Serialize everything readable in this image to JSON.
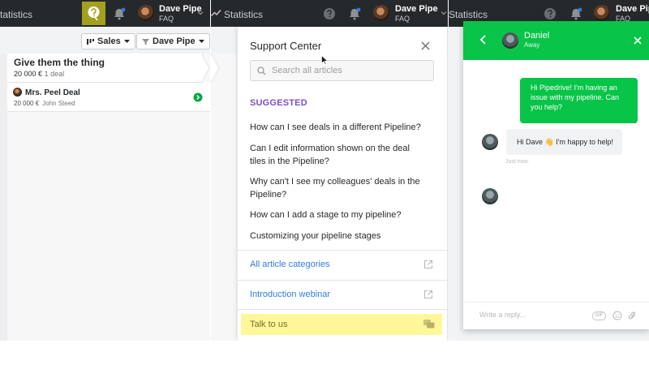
{
  "panel1": {
    "topbar": {
      "nav_label": "tatistics",
      "user_name": "Dave Pipe",
      "user_sub": "FAQ"
    },
    "toolbar": {
      "pipeline_label": "Sales",
      "filter_label": "Dave Pipe"
    },
    "stage": {
      "title": "Give them the thing",
      "amount": "20 000 €",
      "count": "1 deal"
    },
    "deal": {
      "title": "Mrs. Peel Deal",
      "amount": "20 000 €",
      "person": "John Steed"
    }
  },
  "panel2": {
    "topbar": {
      "nav_label": "Statistics",
      "user_name": "Dave Pipe",
      "user_sub": "FAQ"
    }
  },
  "support": {
    "title": "Support Center",
    "search_placeholder": "Search all articles",
    "suggested_label": "SUGGESTED",
    "articles": [
      "How can I see deals in a different Pipeline?",
      "Can I edit information shown on the deal tiles in the Pipeline?",
      "Why can't I see my colleagues' deals in the Pipeline?",
      "How can I add a stage to my pipeline?",
      "Customizing your pipeline stages"
    ],
    "links": [
      "All article categories",
      "Introduction webinar"
    ],
    "talk_label": "Talk to us"
  },
  "panel3": {
    "topbar": {
      "nav_label": "Statistics",
      "user_name": "Dave Pipe",
      "user_sub": "FAQ"
    }
  },
  "chat": {
    "agent_name": "Daniel",
    "agent_status": "Away",
    "user_message": "Hi Pipedrive! I'm having an issue with my pipeline. Can you help?",
    "agent_message": "Hi Dave 👋 I'm happy to help!",
    "timestamp": "Just now.",
    "composer_placeholder": "Write a reply...",
    "gif_label": "GIF"
  },
  "colors": {
    "topbar": "#26292c",
    "help_active": "#a3a01f",
    "suggested": "#7c4fc2",
    "link": "#317ae2",
    "talk_highlight": "#fff79a",
    "chat_green": "#08c448"
  },
  "icons": [
    "lightbulb-icon",
    "bell-icon",
    "help-icon",
    "trend-icon",
    "search-icon",
    "close-icon",
    "external-link-icon",
    "chat-icon",
    "back-arrow-icon",
    "emoji-icon",
    "attach-icon"
  ]
}
